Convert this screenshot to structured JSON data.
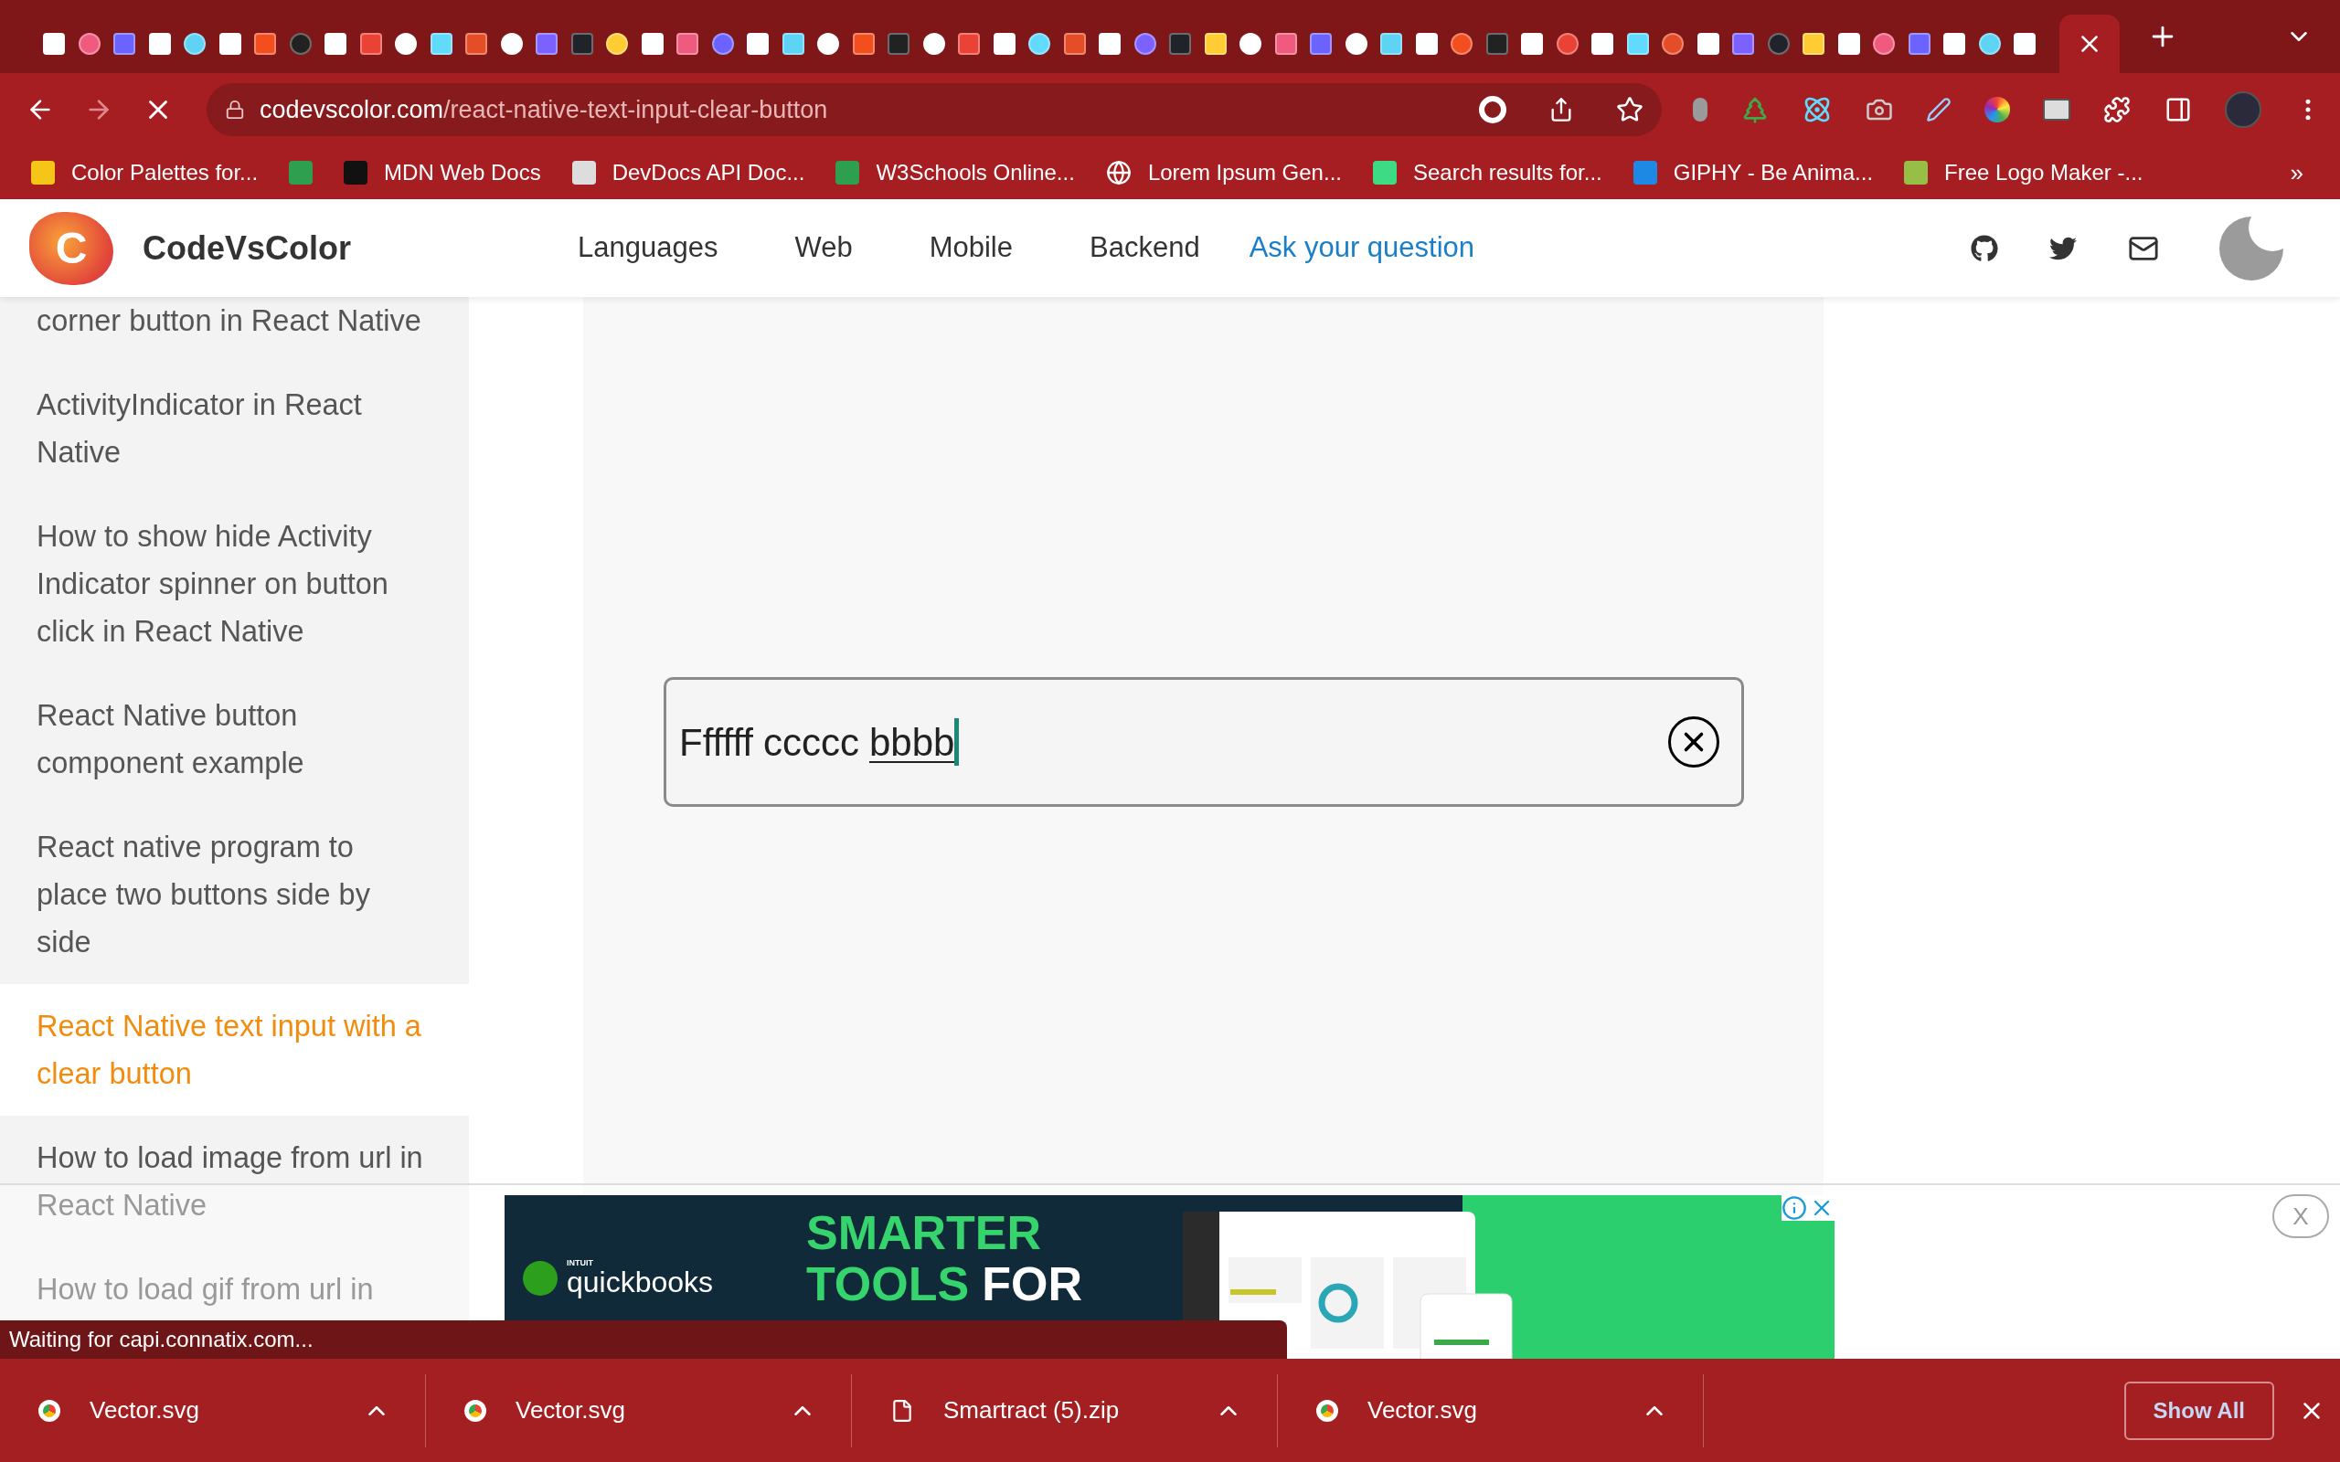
{
  "browser": {
    "tabs": [
      {
        "selected": false
      },
      {
        "selected": false
      },
      {
        "selected": false
      },
      {
        "selected": false
      },
      {
        "selected": false
      },
      {
        "selected": false
      },
      {
        "selected": false
      },
      {
        "selected": false
      },
      {
        "selected": false
      },
      {
        "selected": false
      },
      {
        "selected": false
      },
      {
        "selected": false
      },
      {
        "selected": false
      },
      {
        "selected": false
      },
      {
        "selected": false
      },
      {
        "selected": false
      },
      {
        "selected": false
      },
      {
        "selected": false
      },
      {
        "selected": false
      },
      {
        "selected": false
      },
      {
        "selected": false
      },
      {
        "selected": false
      },
      {
        "selected": false
      },
      {
        "selected": false
      },
      {
        "selected": false
      },
      {
        "selected": false
      },
      {
        "selected": false
      },
      {
        "selected": false
      },
      {
        "selected": false
      },
      {
        "selected": false
      },
      {
        "selected": false
      },
      {
        "selected": false
      },
      {
        "selected": false
      },
      {
        "selected": false
      },
      {
        "selected": false
      },
      {
        "selected": false
      },
      {
        "selected": false
      },
      {
        "selected": false
      },
      {
        "selected": false
      },
      {
        "selected": false
      },
      {
        "selected": false
      },
      {
        "selected": false
      },
      {
        "selected": false
      },
      {
        "selected": false
      },
      {
        "selected": false
      },
      {
        "selected": false
      },
      {
        "selected": false
      },
      {
        "selected": false
      },
      {
        "selected": false
      },
      {
        "selected": false
      },
      {
        "selected": false
      },
      {
        "selected": false
      },
      {
        "selected": false
      },
      {
        "selected": false
      },
      {
        "selected": false
      },
      {
        "selected": false
      },
      {
        "selected": false
      },
      {
        "selected": true
      }
    ],
    "url": {
      "host": "codevscolor.com",
      "path": "/react-native-text-input-clear-button"
    },
    "bookmarks": [
      {
        "kind": "text",
        "label": "Color Palettes for..."
      },
      {
        "kind": "icon"
      },
      {
        "kind": "text",
        "label": "MDN Web Docs"
      },
      {
        "kind": "text",
        "label": "DevDocs API Doc..."
      },
      {
        "kind": "text",
        "label": "W3Schools Online..."
      },
      {
        "kind": "text",
        "label": "Lorem Ipsum Gen..."
      },
      {
        "kind": "text",
        "label": "Search results for..."
      },
      {
        "kind": "text",
        "label": "GIPHY - Be Anima..."
      },
      {
        "kind": "text",
        "label": "Free Logo Maker -..."
      }
    ],
    "bookmarks_more": "»"
  },
  "site": {
    "logo_letter": "C",
    "name": "CodeVsColor",
    "nav": [
      {
        "label": "Languages",
        "kind": "menu"
      },
      {
        "label": "Web",
        "kind": "menu"
      },
      {
        "label": "Mobile",
        "kind": "menu"
      },
      {
        "label": "Backend",
        "kind": "menu"
      },
      {
        "label": "Ask your question",
        "kind": "link"
      }
    ]
  },
  "sidebar": {
    "items": [
      {
        "label": "corner button in React Native",
        "selected": false
      },
      {
        "label": "ActivityIndicator in React Native",
        "selected": false
      },
      {
        "label": "How to show hide Activity Indicator spinner on button click in React Native",
        "selected": false
      },
      {
        "label": "React Native button component example",
        "selected": false
      },
      {
        "label": "React native program to place two buttons side by side",
        "selected": false
      },
      {
        "label": "React Native text input with a clear button",
        "selected": true
      },
      {
        "label": "How to load image from url in React Native",
        "selected": false
      },
      {
        "label": "How to load gif from url in",
        "selected": false
      }
    ]
  },
  "demo_input": {
    "words": [
      {
        "text": "Ffffff",
        "misspelled": false
      },
      {
        "text": "ccccc",
        "misspelled": false
      },
      {
        "text": "bbbb",
        "misspelled": true
      }
    ],
    "focused": true
  },
  "ad": {
    "brand_small": "INTUIT",
    "brand": "quickbooks",
    "headline": [
      [
        {
          "text": "SMARTER",
          "highlight": true
        }
      ],
      [
        {
          "text": "TOOLS",
          "highlight": true
        },
        {
          "text": "FOR",
          "highlight": false
        }
      ]
    ],
    "dismiss": "X"
  },
  "status": "Waiting for capi.connatix.com...",
  "downloads": {
    "items": [
      {
        "name": "Vector.svg",
        "kind": "image"
      },
      {
        "name": "Vector.svg",
        "kind": "image"
      },
      {
        "name": "Smartract (5).zip",
        "kind": "file"
      },
      {
        "name": "Vector.svg",
        "kind": "image"
      }
    ],
    "show_all": "Show All"
  }
}
